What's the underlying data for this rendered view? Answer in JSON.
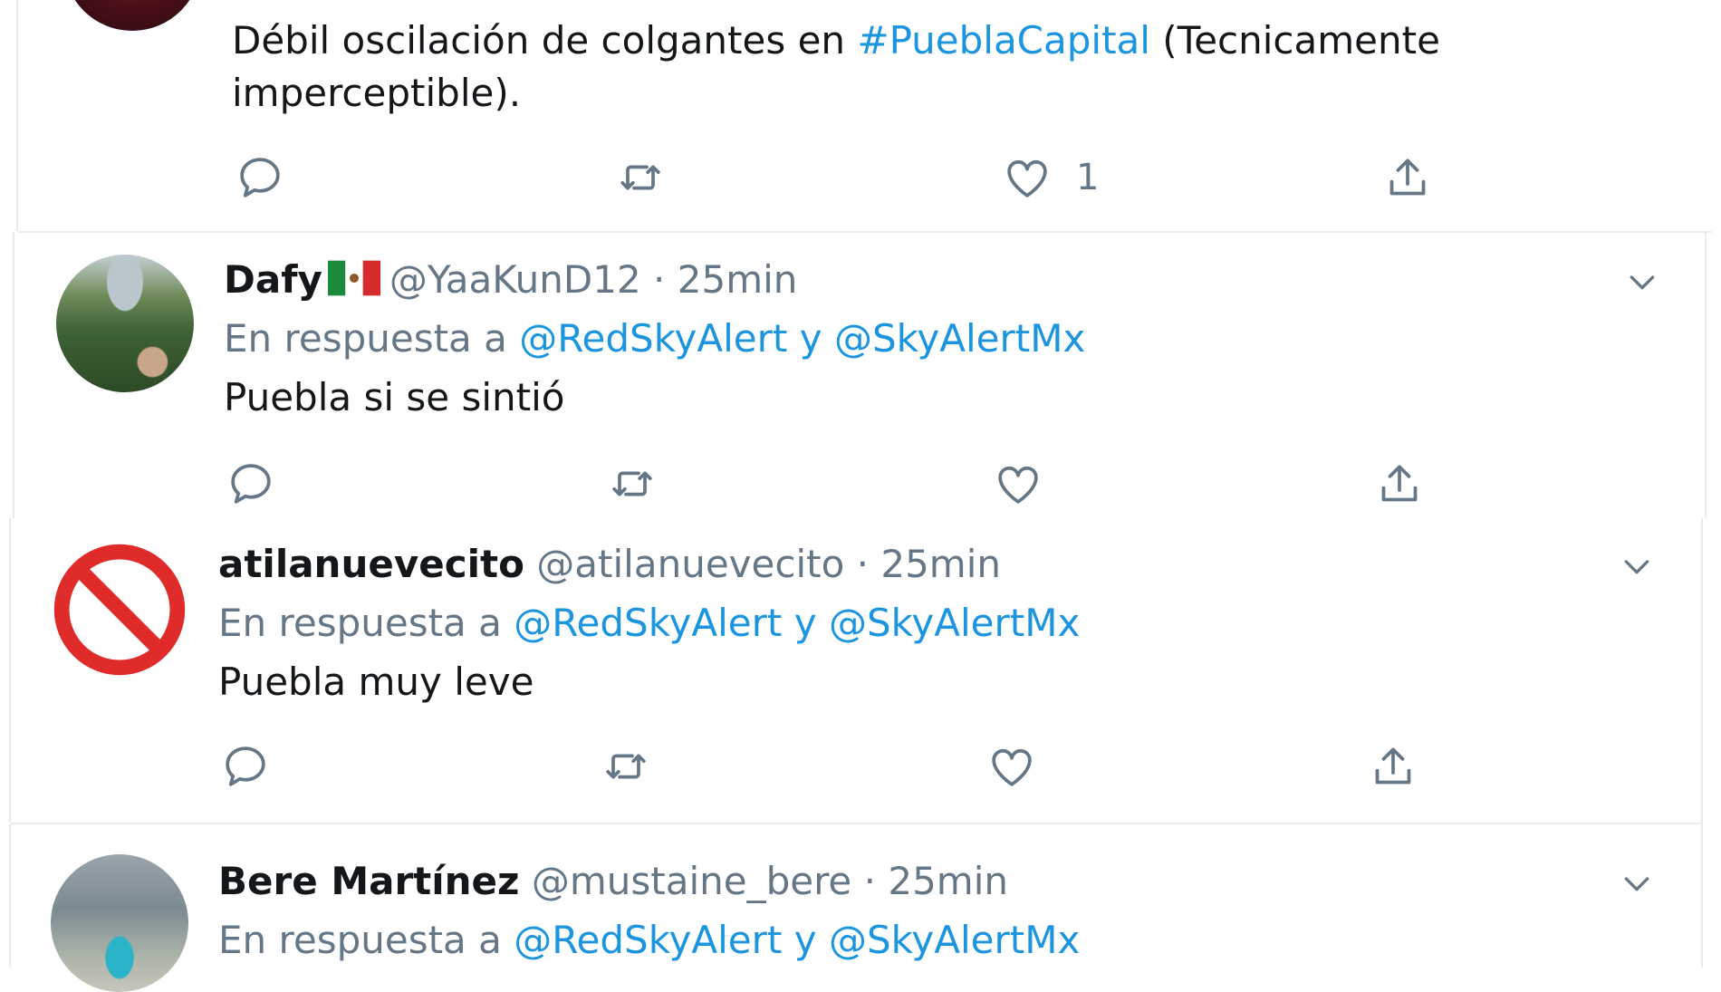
{
  "tweets": [
    {
      "text_before": "Débil oscilación de colgantes en ",
      "hashtag": "#PueblaCapital",
      "text_after": " (Tecnicamente imperceptible).",
      "like_count": "1"
    },
    {
      "name": "Dafy",
      "flag_icon": "mexico-flag-icon",
      "handle": "@YaaKunD12",
      "separator": "·",
      "time": "25min",
      "reply_prefix": "En respuesta a",
      "mention_1": "@RedSkyAlert",
      "conj": "y",
      "mention_2": "@SkyAlertMx",
      "text": "Puebla si se sintió"
    },
    {
      "name": "atilanuevecito",
      "handle": "@atilanuevecito",
      "separator": "·",
      "time": "25min",
      "reply_prefix": "En respuesta a",
      "mention_1": "@RedSkyAlert",
      "conj": "y",
      "mention_2": "@SkyAlertMx",
      "text": "Puebla muy leve"
    },
    {
      "name": "Bere Martínez",
      "handle": "@mustaine_bere",
      "separator": "·",
      "time": "25min",
      "reply_prefix": "En respuesta a",
      "mention_1": "@RedSkyAlert",
      "conj": "y",
      "mention_2": "@SkyAlertMx"
    }
  ],
  "icons": {
    "reply": "reply-icon",
    "retweet": "retweet-icon",
    "like": "heart-icon",
    "share": "share-icon",
    "menu": "chevron-down-icon"
  },
  "colors": {
    "link": "#1b95e0",
    "secondary_text": "#657786",
    "primary_text": "#14171a",
    "divider": "#e6ecf0",
    "blocked_red": "#e02b2b"
  }
}
